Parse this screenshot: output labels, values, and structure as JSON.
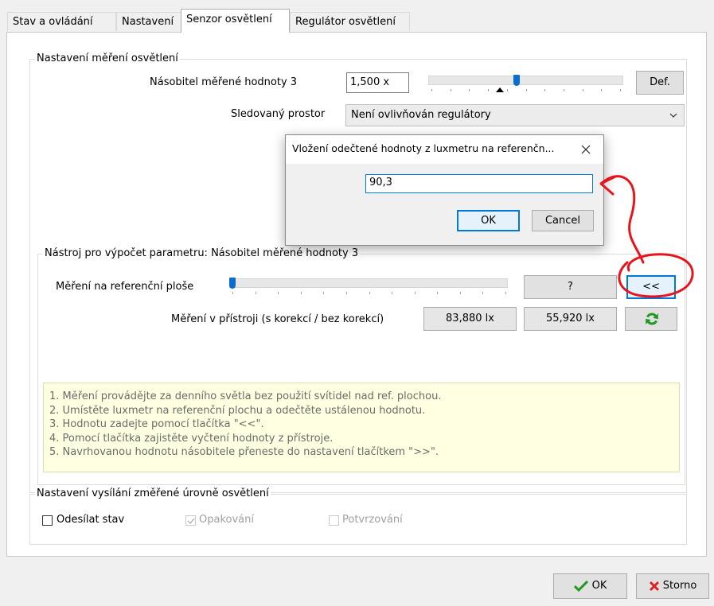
{
  "tabs": [
    {
      "label": "Stav a ovládání"
    },
    {
      "label": "Nastavení"
    },
    {
      "label": "Senzor osvětlení",
      "active": true
    },
    {
      "label": "Regulátor osvětlení"
    }
  ],
  "measurement_group": {
    "title": "Nastavení měření osvětlení",
    "multiplier_label": "Násobitel měřené hodnoty 3",
    "multiplier_value": "1,500 x",
    "multiplier_slider_fraction": 0.45,
    "def_button": "Def.",
    "space_label": "Sledovaný prostor",
    "space_value": "Není ovlivňován regulátory"
  },
  "tool_group": {
    "title": "Nástroj pro výpočet parametru: Násobitel měřené hodnoty 3",
    "reference_label": "Měření na referenční ploše",
    "reference_slider_fraction": 0.0,
    "question_button": "?",
    "insert_button": "<<",
    "device_label": "Měření v přístroji (s korekcí / bez korekcí)",
    "with_correction": "83,880 lx",
    "without_correction": "55,920 lx",
    "instructions": [
      "1. Měření provádějte za denního světla bez použití svítidel nad ref. plochou.",
      "2. Umístěte luxmetr na referenční plochu a odečtěte ustálenou hodnotu.",
      "3. Hodnotu zadejte pomocí tlačítka \"<<\".",
      "4. Pomocí tlačítka zajistěte vyčtení hodnoty z přístroje.",
      "5. Navrhovanou hodnotu násobitele přeneste do nastavení tlačítkem \">>\"."
    ]
  },
  "send_group": {
    "title": "Nastavení vysílání změřené úrovně osvětlení",
    "send_state": "Odesílat stav",
    "repeat": "Opakování",
    "confirm": "Potvrzování"
  },
  "footer": {
    "ok": "OK",
    "cancel": "Storno"
  },
  "dialog": {
    "title": "Vložení odečtené hodnoty z luxmetru na referenčn...",
    "value": "90,3",
    "ok": "OK",
    "cancel": "Cancel"
  },
  "colors": {
    "accent": "#0078d7",
    "annotation": "#e8141c",
    "refresh": "#1f9a1f",
    "info_bg": "#ffffe1"
  }
}
